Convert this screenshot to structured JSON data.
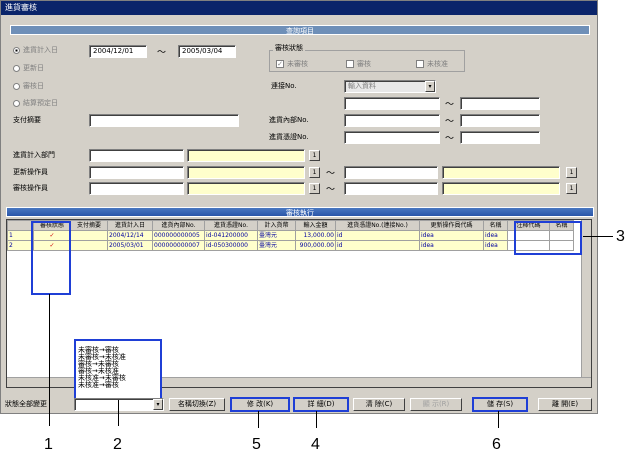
{
  "window": {
    "title": "進貨審核"
  },
  "query_section": {
    "title": "查詢項目"
  },
  "radios": [
    {
      "label": "進貨計入日",
      "on": true
    },
    {
      "label": "更新日",
      "on": false
    },
    {
      "label": "審核日",
      "on": false
    },
    {
      "label": "結算預定日",
      "on": false
    }
  ],
  "date_from": "2004/12/01",
  "date_to": "2005/03/04",
  "tilde": "～",
  "status_group": {
    "title": "審核狀態",
    "items": [
      "未審核",
      "審核",
      "未核准"
    ]
  },
  "labels": {
    "payment_summary": "支付摘要",
    "contact_no": "連接No.",
    "inbound_internal_no": "進貨內部No.",
    "inbound_slip_no": "進貨憑證No.",
    "dept": "進貨計入部門",
    "updater": "更新操作員",
    "reviewer": "審核操作員"
  },
  "contact_select": "輸入資料",
  "lookup_btn": "1",
  "results_section": {
    "title": "審核執行"
  },
  "table": {
    "headers": [
      "審核狀態",
      "支付摘要",
      "進貨計入日",
      "進貨內部No.",
      "進貨憑證No.",
      "計入貨幣",
      "輸入金額",
      "進貨憑證No.(連接No.)",
      "更新操作員代碼",
      "名稱",
      "注釋代碼",
      "名稱"
    ],
    "rows": [
      {
        "num": "1",
        "date": "2004/12/14",
        "internal": "000000000005",
        "slip": "id-041200000",
        "currency": "臺灣元",
        "amount": "13,000.00",
        "link": "id",
        "updater": "idea",
        "name": "idea"
      },
      {
        "num": "2",
        "date": "2005/03/01",
        "internal": "000000000007",
        "slip": "id-050300000",
        "currency": "臺灣元",
        "amount": "900,000.00",
        "link": "id",
        "updater": "idea",
        "name": "idea"
      }
    ]
  },
  "dropdown_options": [
    "未審核→審核",
    "未審核→未核准",
    "審核→未審核",
    "審核→未核准",
    "未核准→未審核",
    "未核准→審核"
  ],
  "footer": {
    "status_select": "狀態全部變更"
  },
  "buttons": {
    "name_toggle": "名稱切換(Z)",
    "modify": "修 改(K)",
    "detail": "詳 細(D)",
    "clear": "清 除(C)",
    "display": "顯 示(R)",
    "save": "儲 存(S)",
    "close": "離 開(E)"
  },
  "callouts": [
    "1",
    "2",
    "3",
    "4",
    "5",
    "6"
  ],
  "colors": {
    "highlight": "#1f3fd6",
    "titlebar": "#0a246a",
    "yellow_field": "#ffffcc"
  }
}
